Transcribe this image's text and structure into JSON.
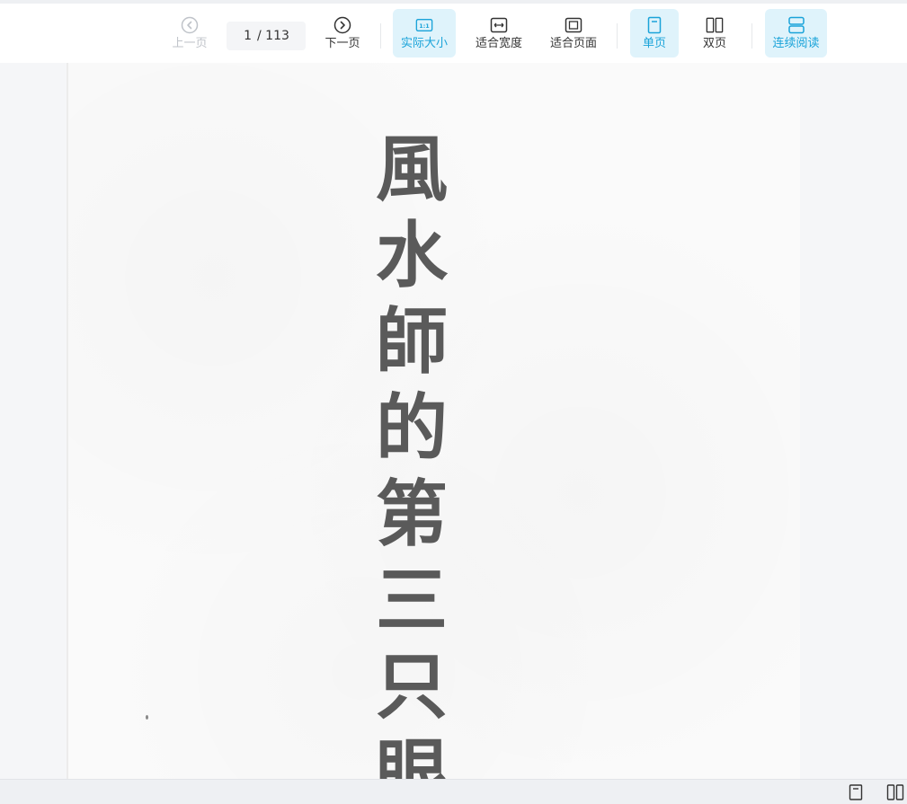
{
  "toolbar": {
    "prev_label": "上一页",
    "next_label": "下一页",
    "current_page": "1",
    "total_pages": "/ 113",
    "actual_size_label": "实际大小",
    "fit_width_label": "适合宽度",
    "fit_page_label": "适合页面",
    "single_page_label": "单页",
    "double_page_label": "双页",
    "continuous_label": "连续阅读",
    "actual_size_icon_text": "1:1"
  },
  "document": {
    "title_chars": [
      "風",
      "水",
      "師",
      "的",
      "第",
      "三",
      "只",
      "眼"
    ]
  },
  "colors": {
    "accent": "#1aa3d9",
    "active_bg": "#dff3fb",
    "disabled": "#bfc3c9"
  }
}
